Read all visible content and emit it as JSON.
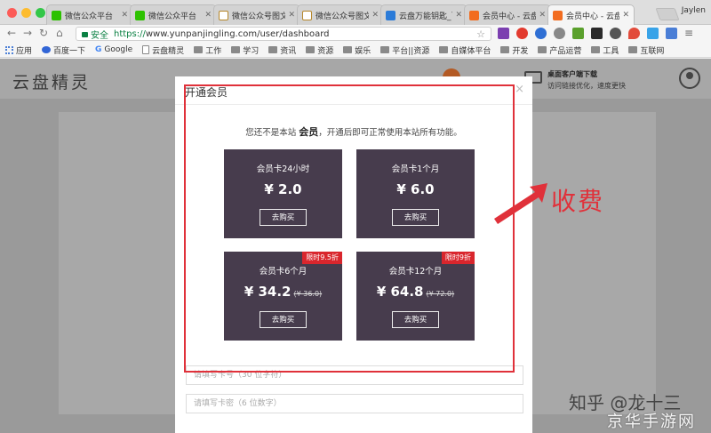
{
  "browser": {
    "tabs": [
      {
        "title": "微信公众平台",
        "icon": "wechat-icon",
        "active": false
      },
      {
        "title": "微信公众平台",
        "icon": "wechat-icon",
        "active": false
      },
      {
        "title": "微信公众号图文",
        "icon": "doc-icon",
        "active": false
      },
      {
        "title": "微信公众号图文",
        "icon": "doc-icon",
        "active": false
      },
      {
        "title": "云盘万能钥匙_百",
        "icon": "key-icon",
        "active": false
      },
      {
        "title": "会员中心 - 云盘",
        "icon": "cloud-icon",
        "active": false
      },
      {
        "title": "会员中心 - 云盘",
        "icon": "cloud-icon",
        "active": true
      }
    ],
    "user": "Jaylen",
    "secure_label": "安全",
    "url_scheme": "https://",
    "url_rest": "www.yunpanjingling.com/user/dashboard",
    "bookmarks": [
      "应用",
      "百度一下",
      "Google",
      "云盘精灵",
      "工作",
      "学习",
      "资讯",
      "资源",
      "娱乐",
      "平台||资源",
      "自媒体平台",
      "开发",
      "产品运营",
      "工具",
      "互联网"
    ]
  },
  "site": {
    "logo": "云盘精灵",
    "download_title": "桌面客户端下载",
    "download_sub": "访问链接优化，速度更快"
  },
  "modal": {
    "title": "开通会员",
    "close": "×",
    "notice_pre": "您还不是本站 ",
    "notice_bold": "会员",
    "notice_post": "，开通后即可正常使用本站所有功能。",
    "cards": [
      {
        "name": "会员卡24小时",
        "price": "¥ 2.0",
        "original": "",
        "badge": "",
        "button": "去购买"
      },
      {
        "name": "会员卡1个月",
        "price": "¥ 6.0",
        "original": "",
        "badge": "",
        "button": "去购买"
      },
      {
        "name": "会员卡6个月",
        "price": "¥ 34.2",
        "original": "(¥ 36.0)",
        "badge": "限时9.5折",
        "button": "去购买"
      },
      {
        "name": "会员卡12个月",
        "price": "¥ 64.8",
        "original": "(¥ 72.0)",
        "badge": "限时9折",
        "button": "去购买"
      }
    ],
    "card_no_placeholder": "请填写卡号（30 位字符）",
    "card_pwd_placeholder": "请填写卡密（6 位数字）"
  },
  "annotation": {
    "text": "收费",
    "color": "#e0313a"
  },
  "watermark": {
    "line1": "知乎 @龙十三",
    "line2": "京华手游网"
  }
}
